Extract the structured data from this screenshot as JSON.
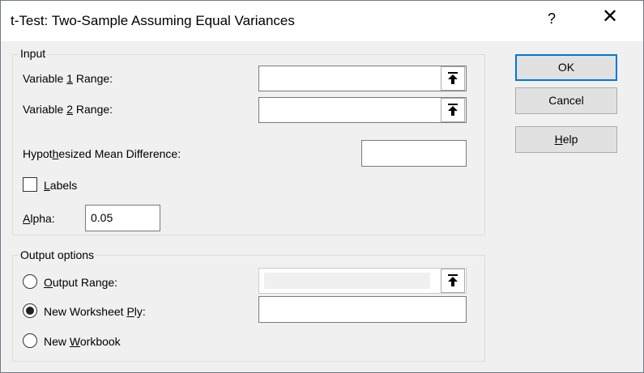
{
  "window": {
    "title": "t-Test: Two-Sample Assuming Equal Variances",
    "help_icon": "?",
    "close_icon": "✕"
  },
  "input_group": {
    "label": "Input",
    "var1_label": {
      "pre": "Variable ",
      "key": "1",
      "post": " Range:"
    },
    "var1_value": "",
    "var2_label": {
      "pre": "Variable ",
      "key": "2",
      "post": " Range:"
    },
    "var2_value": "",
    "hyp_label": {
      "pre": "Hypot",
      "key": "h",
      "post": "esized Mean Difference:"
    },
    "hyp_value": "",
    "labels_checkbox": {
      "pre": "",
      "key": "L",
      "post": "abels",
      "checked": false
    },
    "alpha_label": {
      "pre": "",
      "key": "A",
      "post": "lpha:"
    },
    "alpha_value": "0.05"
  },
  "output_group": {
    "label": "Output options",
    "output_range": {
      "pre": "",
      "key": "O",
      "post": "utput Range:",
      "selected": false,
      "value": ""
    },
    "new_worksheet": {
      "pre": "New Worksheet ",
      "key": "P",
      "post": "ly:",
      "selected": true,
      "value": ""
    },
    "new_workbook": {
      "pre": "New ",
      "key": "W",
      "post": "orkbook",
      "selected": false
    }
  },
  "buttons": {
    "ok": "OK",
    "cancel": "Cancel",
    "help": {
      "pre": "",
      "key": "H",
      "post": "elp"
    }
  },
  "icons": {
    "ref_button_icon": "upload-arrow-icon",
    "ref_glyph": "⭱"
  }
}
